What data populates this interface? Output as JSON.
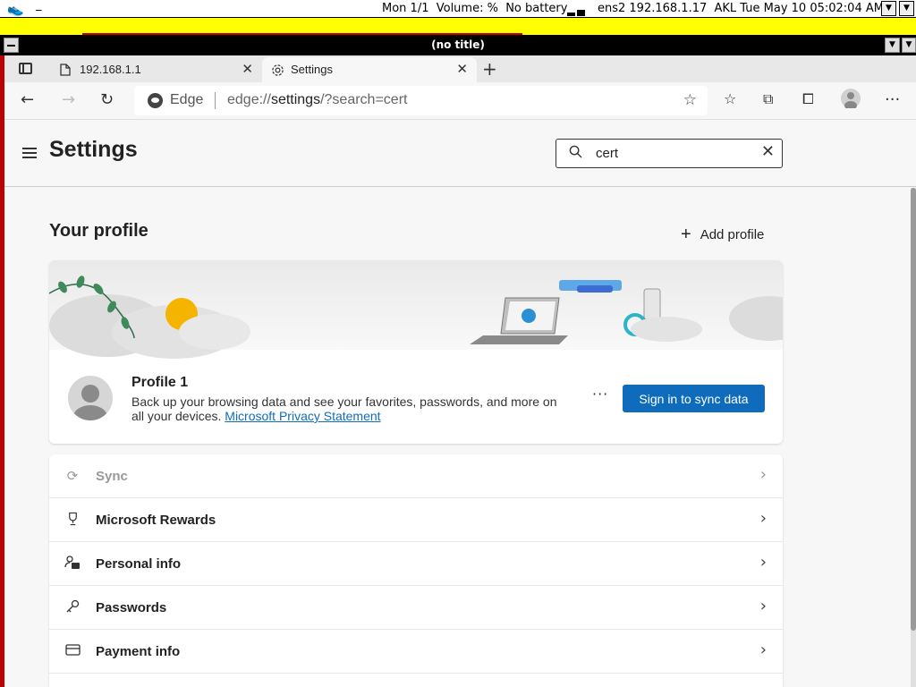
{
  "system_bar": {
    "status_left": "Mon 1/1  Volume: %  No battery",
    "status_right": "ens2 192.168.1.17  AKL Tue May 10 05:02:04 AM",
    "dash": "_"
  },
  "window": {
    "title": "(no title)"
  },
  "tabs": [
    {
      "label": "192.168.1.1",
      "icon": "page-icon",
      "active": false
    },
    {
      "label": "Settings",
      "icon": "gear-icon",
      "active": true
    }
  ],
  "address": {
    "browser_label": "Edge",
    "url_prefix": "edge://",
    "url_host": "settings",
    "url_rest": "/?search=cert"
  },
  "settings": {
    "title": "Settings",
    "search_value": "cert"
  },
  "profile_section": {
    "heading": "Your profile",
    "add_profile_label": "Add profile",
    "profile_name": "Profile 1",
    "description": "Back up your browsing data and see your favorites, passwords, and more on all your devices.",
    "privacy_link": "Microsoft Privacy Statement",
    "more_label": "···",
    "sign_in_label": "Sign in to sync data"
  },
  "list_items": [
    {
      "label": "Sync",
      "icon": "sync-icon",
      "disabled": true
    },
    {
      "label": "Microsoft Rewards",
      "icon": "trophy-icon",
      "disabled": false
    },
    {
      "label": "Personal info",
      "icon": "person-card-icon",
      "disabled": false
    },
    {
      "label": "Passwords",
      "icon": "key-icon",
      "disabled": false
    },
    {
      "label": "Payment info",
      "icon": "credit-card-icon",
      "disabled": false
    }
  ],
  "colors": {
    "accent": "#0f6cbd",
    "desktop": "#ffff00",
    "frame_red": "#c00000"
  }
}
